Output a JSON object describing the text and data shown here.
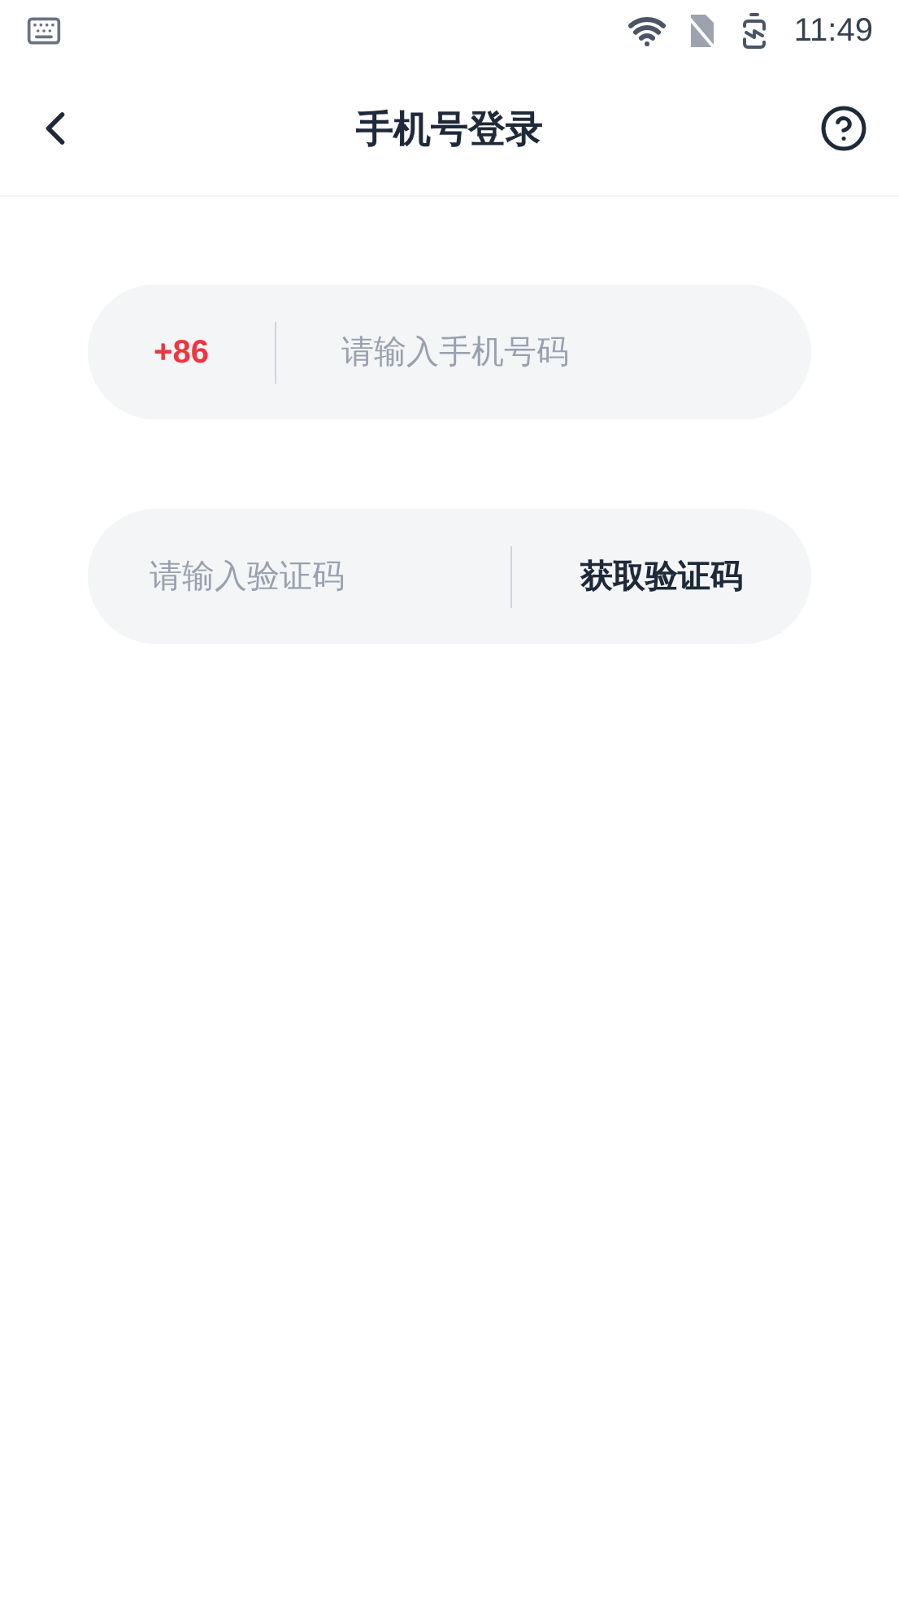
{
  "status_bar": {
    "time": "11:49"
  },
  "header": {
    "title": "手机号登录"
  },
  "phone_field": {
    "country_code": "+86",
    "placeholder": "请输入手机号码"
  },
  "code_field": {
    "placeholder": "请输入验证码",
    "button": "获取验证码"
  }
}
